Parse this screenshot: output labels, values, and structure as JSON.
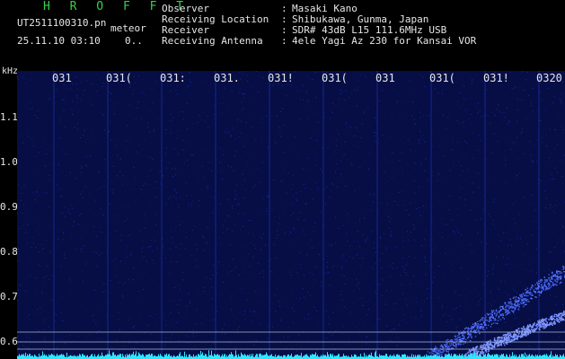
{
  "header": {
    "brand": "H R O F F T",
    "filename": "UT2511100310.pn",
    "meteor_label": "meteor",
    "datetime": "25.11.10 03:10",
    "count": "0..",
    "meta": [
      {
        "key": "Observer",
        "value": "Masaki Kano"
      },
      {
        "key": "Receiving Location",
        "value": "Shibukawa, Gunma, Japan"
      },
      {
        "key": "Receiver",
        "value": "SDR# 43dB L15 111.6MHz USB"
      },
      {
        "key": "Receiving Antenna",
        "value": "4ele Yagi Az 230 for Kansai VOR"
      }
    ]
  },
  "axes": {
    "unit": "kHz",
    "y_ticks": [
      "1.1",
      "1.0",
      "0.9",
      "0.8",
      "0.7",
      "0.6"
    ],
    "time_ticks": [
      "031",
      "031(",
      "031:",
      "031.",
      "031!",
      "031(",
      "031",
      "031(",
      "031!",
      "0320"
    ]
  },
  "colors": {
    "background": "#000000",
    "plot_bg": "#060e45",
    "brand": "#35d24a",
    "text": "#e6e6e6",
    "signal": "#5a78ff",
    "noise_floor": "#2ee6ff"
  }
}
